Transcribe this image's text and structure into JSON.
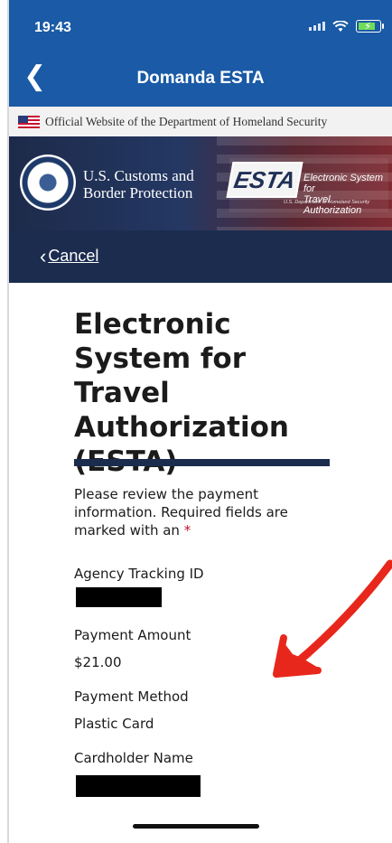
{
  "status_bar": {
    "time": "19:43"
  },
  "app_bar": {
    "title": "Domanda ESTA",
    "back_icon": "chevron-left-icon"
  },
  "official_banner": {
    "text": "Official Website of the Department of Homeland Security",
    "flag_icon": "us-flag-icon"
  },
  "header_banner": {
    "agency_line1": "U.S. Customs and",
    "agency_line2": "Border Protection",
    "esta_logo": "ESTA",
    "esta_desc_line1": "Electronic System for",
    "esta_desc_line2": "Travel Authorization",
    "esta_sub": "U.S. Department of Homeland Security"
  },
  "cancel_bar": {
    "label": "Cancel"
  },
  "page": {
    "title_line1": "Electronic",
    "title_line2": "System for Travel",
    "title_line3": "Authorization",
    "title_line4": "(ESTA)",
    "instructions_line1": "Please review the payment",
    "instructions_line2": "information. Required fields are",
    "instructions_line3": "marked with an",
    "required_marker": "*"
  },
  "fields": {
    "agency_tracking_id_label": "Agency Tracking ID",
    "payment_amount_label": "Payment Amount",
    "payment_amount_value": "$21.00",
    "payment_method_label": "Payment Method",
    "payment_method_value": "Plastic Card",
    "cardholder_name_label": "Cardholder Name"
  },
  "colors": {
    "app_bar": "#1a5aa6",
    "cancel_bar": "#1b2c4f",
    "required": "#c8102e",
    "annotation_arrow": "#e8271c"
  }
}
